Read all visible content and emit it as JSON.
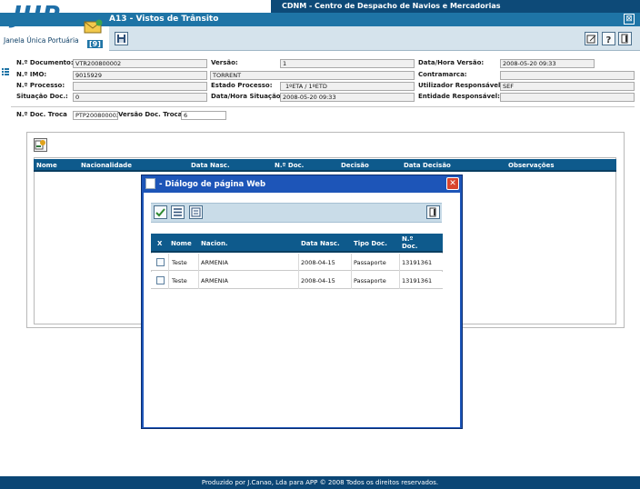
{
  "app": {
    "logo": "JUP",
    "logo_subtitle": "Janela Única Portuária",
    "counter_badge": "[9]",
    "header": "CDNM - Centro de Despacho de Navios e Mercadorias",
    "title": "A13 - Vistos de Trânsito",
    "close_label": "⊠"
  },
  "form": {
    "doc_number_label": "N.º Documento:",
    "doc_number": "VTR200800002",
    "imo_label": "N.º IMO:",
    "imo": "9015929",
    "process_label": "N.º Processo:",
    "process": "",
    "doc_state_label": "Situação Doc.:",
    "doc_state": "0",
    "version_label": "Versão:",
    "version": "1",
    "ship_name": "TORRENT",
    "process_state_label": "Estado Processo:",
    "process_state": "1ºETA    /    1ºETD",
    "state_datetime_label": "Data/Hora Situação:",
    "state_datetime": "2008-05-20 09:33",
    "version_datetime_label": "Data/Hora Versão:",
    "version_datetime": "2008-05-20 09:33",
    "contramarca_label": "Contramarca:",
    "contramarca": "",
    "responsible_user_label": "Utilizador Responsável:",
    "responsible_user": "SEF",
    "responsible_entity_label": "Entidade Responsável:",
    "responsible_entity": "",
    "exchange_doc_label": "N.º Doc. Troca",
    "exchange_doc": "PTP200800002",
    "exchange_version_label": "Versão Doc. Troca",
    "exchange_version": "6"
  },
  "grid": {
    "columns": [
      "Nome",
      "Nacionalidade",
      "Data Nasc.",
      "N.º Doc.",
      "Decisão",
      "Data Decisão",
      "Observações"
    ]
  },
  "dialog": {
    "title": "- Diálogo de página Web",
    "close_label": "✕",
    "columns": [
      "X",
      "Nome",
      "Nacion.",
      "Data Nasc.",
      "Tipo Doc.",
      "N.º Doc."
    ],
    "rows": [
      {
        "name": "Teste",
        "nationality": "ARMENIA",
        "birth_date": "2008-04-15",
        "doc_type": "Passaporte",
        "doc_number": "13191361"
      },
      {
        "name": "Teste",
        "nationality": "ARMENIA",
        "birth_date": "2008-04-15",
        "doc_type": "Passaporte",
        "doc_number": "13191361"
      }
    ]
  },
  "footer": {
    "text": "Produzido por J.Canao, Lda para APP © 2008 Todos os direitos reservados."
  },
  "colors": {
    "accent": "#1e74a6",
    "header_dark": "#0d4a78",
    "grid_header": "#0e5a8c",
    "dialog_frame": "#1d55b8"
  }
}
